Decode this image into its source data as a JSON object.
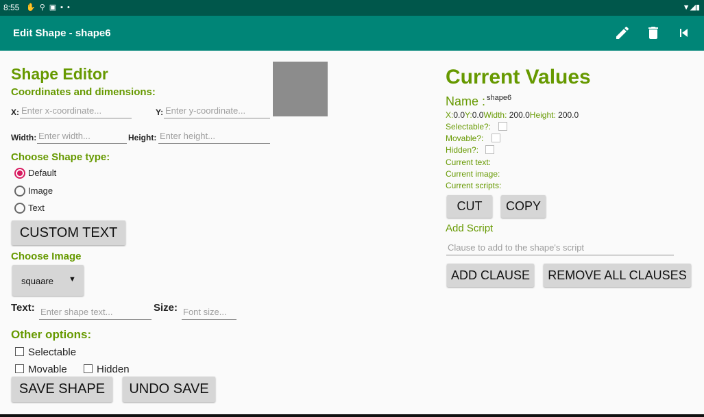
{
  "status": {
    "time": "8:55"
  },
  "appbar": {
    "title": "Edit Shape - shape6"
  },
  "editor": {
    "heading": "Shape Editor",
    "coords_heading": "Coordinates and dimensions:",
    "x_label": "X:",
    "x_placeholder": "Enter x-coordinate...",
    "y_label": "Y:",
    "y_placeholder": "Enter y-coordinate...",
    "width_label": "Width:",
    "width_placeholder": "Enter width...",
    "height_label": "Height:",
    "height_placeholder": "Enter height...",
    "shape_type_heading": "Choose Shape type:",
    "types": [
      "Default",
      "Image",
      "Text"
    ],
    "custom_text_button": "CUSTOM TEXT",
    "image_heading": "Choose Image",
    "image_selected": "squaare",
    "text_label": "Text:",
    "text_placeholder": "Enter shape text...",
    "size_label": "Size:",
    "size_placeholder": "Font size...",
    "other_heading": "Other options:",
    "selectable": "Selectable",
    "movable": "Movable",
    "hidden": "Hidden",
    "save_button": "SAVE SHAPE",
    "undo_button": "UNDO SAVE",
    "preview_color": "#8c8c8c"
  },
  "current": {
    "heading": "Current Values",
    "name_label": "Name :",
    "name_value": "shape6",
    "x_label": "X:",
    "x_value": "0.0",
    "y_label": "Y:",
    "y_value": "0.0",
    "width_label": "Width:",
    "width_value": " 200.0",
    "height_label": "Height:",
    "height_value": " 200.0",
    "selectable_label": "Selectable?:",
    "movable_label": "Movable?:",
    "hidden_label": "Hidden?:",
    "text_label": "Current text:",
    "image_label": "Current image:",
    "scripts_label": "Current scripts:",
    "cut_button": "CUT",
    "copy_button": "COPY",
    "add_script_label": "Add Script",
    "clause_placeholder": "Clause to add to the shape's script",
    "add_clause_button": "ADD CLAUSE",
    "remove_clauses_button": "REMOVE ALL CLAUSES"
  },
  "colors": {
    "primary": "#008577",
    "primary_dark": "#00574b",
    "accent": "#d81b60",
    "label_green": "#669900"
  }
}
